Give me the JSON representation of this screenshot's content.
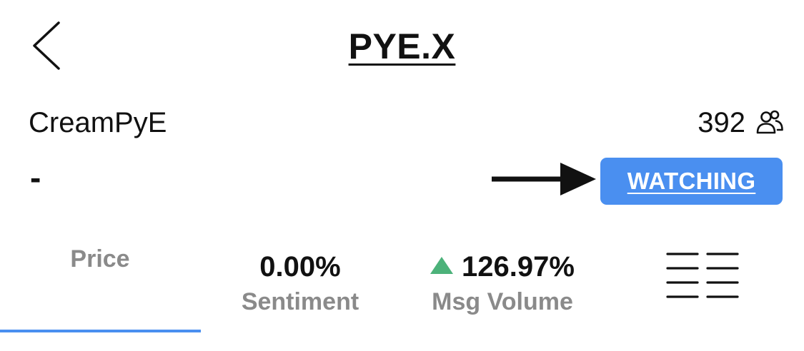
{
  "header": {
    "title": "PYE.X",
    "back_icon": "chevron-left-icon"
  },
  "stock": {
    "company_name": "CreamPyE",
    "price": "-",
    "watchers_count": "392",
    "watchers_icon": "people-icon",
    "watch_button_label": "WATCHING",
    "annotation_icon": "right-arrow-icon"
  },
  "tabs": {
    "price_label": "Price",
    "sentiment_value": "0.00%",
    "sentiment_label": "Sentiment",
    "volume_value": "126.97%",
    "volume_label": "Msg Volume",
    "volume_trend_icon": "up-triangle-icon",
    "menu_icon": "list-menu-icon"
  },
  "colors": {
    "accent": "#4a8ff0",
    "positive": "#4cb27a",
    "muted_text": "#8a8a8a"
  }
}
